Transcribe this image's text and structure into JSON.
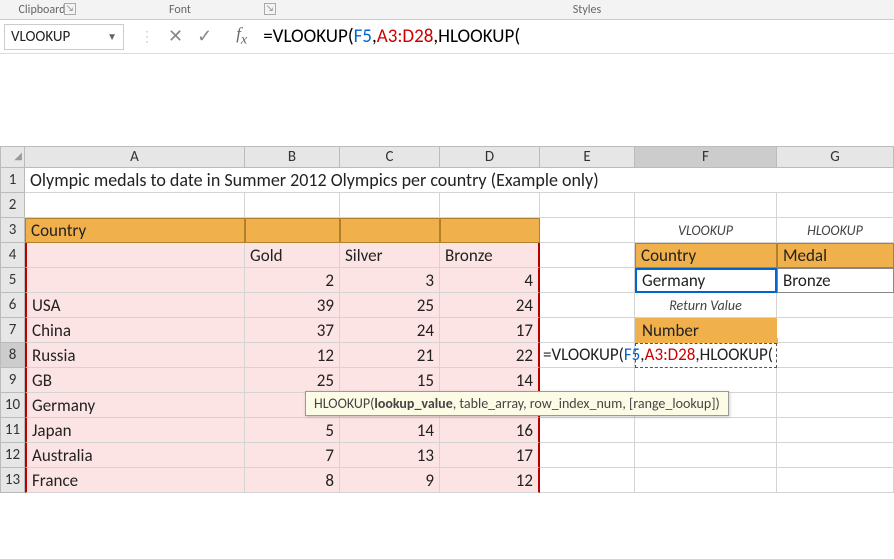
{
  "ribbon": {
    "clipboard": "Clipboard",
    "font": "Font",
    "styles": "Styles"
  },
  "nameBox": "VLOOKUP",
  "formulaBar": {
    "prefix": "=VLOOKUP",
    "arg1": "F5",
    "arg2": "A3:D28",
    "suffix": "HLOOKUP"
  },
  "headers": [
    "",
    "A",
    "B",
    "C",
    "D",
    "E",
    "F",
    "G"
  ],
  "rows": [
    "1",
    "2",
    "3",
    "4",
    "5",
    "6",
    "7",
    "8",
    "9",
    "10",
    "11",
    "12",
    "13"
  ],
  "title": "Olympic medals to date in Summer 2012 Olympics per country (Example only)",
  "lookup": {
    "vlookup_hdr": "VLOOKUP",
    "hlookup_hdr": "HLOOKUP",
    "country_lbl": "Country",
    "medal_lbl": "Medal",
    "country_val": "Germany",
    "medal_val": "Bronze",
    "return_lbl": "Return Value",
    "number_lbl": "Number"
  },
  "table": {
    "header": "Country",
    "cols": [
      "Gold",
      "Silver",
      "Bronze"
    ],
    "data": [
      {
        "country": "",
        "vals": [
          "2",
          "3",
          "4"
        ]
      },
      {
        "country": "USA",
        "vals": [
          "39",
          "25",
          "24"
        ]
      },
      {
        "country": "China",
        "vals": [
          "37",
          "24",
          "17"
        ]
      },
      {
        "country": "Russia",
        "vals": [
          "12",
          "21",
          "22"
        ]
      },
      {
        "country": "GB",
        "vals": [
          "25",
          "15",
          "14"
        ]
      },
      {
        "country": "Germany",
        "vals": [
          "",
          "",
          ""
        ]
      },
      {
        "country": "Japan",
        "vals": [
          "5",
          "14",
          "16"
        ]
      },
      {
        "country": "Australia",
        "vals": [
          "7",
          "13",
          "17"
        ]
      },
      {
        "country": "France",
        "vals": [
          "8",
          "9",
          "12"
        ]
      }
    ]
  },
  "inlineFormula": {
    "prefix": "=VLOOKUP(",
    "arg1": "F5",
    "arg2": "A3:D28",
    "suffix": "HLOOKUP("
  },
  "tooltip": {
    "fn": "HLOOKUP(",
    "bold": "lookup_value",
    "rest": ", table_array, row_index_num, [range_lookup])"
  },
  "chart_data": {
    "type": "table",
    "title": "Olympic medals to date in Summer 2012 Olympics per country (Example only)",
    "columns": [
      "Country",
      "Gold",
      "Silver",
      "Bronze"
    ],
    "rows": [
      [
        "",
        2,
        3,
        4
      ],
      [
        "USA",
        39,
        25,
        24
      ],
      [
        "China",
        37,
        24,
        17
      ],
      [
        "Russia",
        12,
        21,
        22
      ],
      [
        "GB",
        25,
        15,
        14
      ],
      [
        "Germany",
        null,
        null,
        null
      ],
      [
        "Japan",
        5,
        14,
        16
      ],
      [
        "Australia",
        7,
        13,
        17
      ],
      [
        "France",
        8,
        9,
        12
      ]
    ]
  }
}
